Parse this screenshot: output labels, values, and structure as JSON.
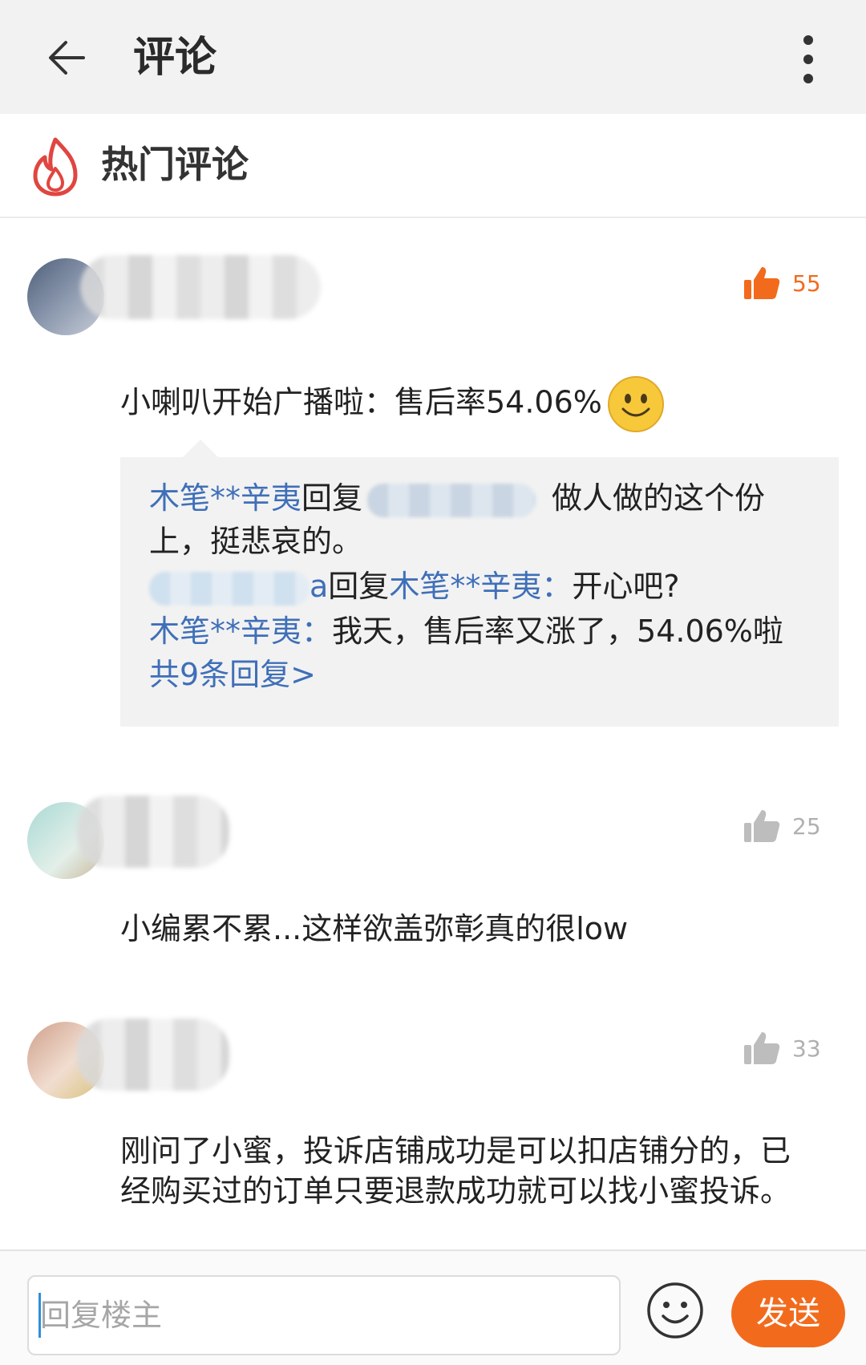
{
  "header": {
    "title": "评论"
  },
  "hot_section": {
    "title": "热门评论"
  },
  "comments": [
    {
      "likes": "55",
      "text": "小喇叭开始广播啦：售后率54.06%",
      "replies": {
        "r1_user": "木笔**辛夷",
        "r1_verb": "回复",
        "r1_text": "做人做的这个份",
        "r1_text2": "上，挺悲哀的。",
        "r2_suffix": "a",
        "r2_verb": "回复",
        "r2_target": "木笔**辛夷：",
        "r2_text": "开心吧?",
        "r3_user": "木笔**辛夷：",
        "r3_text": "我天，售后率又涨了，54.06%啦",
        "more": "共9条回复>"
      }
    },
    {
      "likes": "25",
      "text": "小编累不累...这样欲盖弥彰真的很low"
    },
    {
      "likes": "33",
      "text_line1": "刚问了小蜜，投诉店铺成功是可以扣店铺分的，已",
      "text_line2": "经购买过的订单只要退款成功就可以找小蜜投诉。"
    }
  ],
  "bottom": {
    "placeholder": "回复楼主",
    "send_label": "发送"
  },
  "colors": {
    "accent": "#f26b1d",
    "link": "#3f6fb8",
    "like_active": "#f26b1d",
    "like_inactive": "#bdbdbd"
  }
}
